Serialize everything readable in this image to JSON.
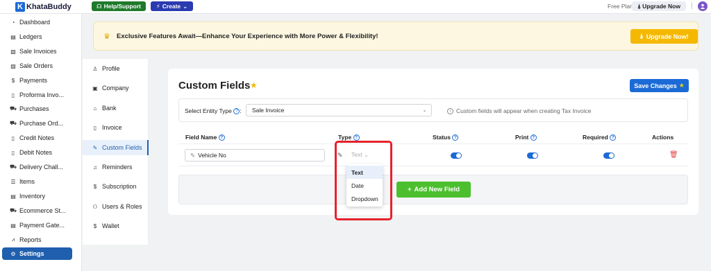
{
  "topbar": {
    "logo_letter": "K",
    "logo_text": "KhataBuddy",
    "help_label": "Help/Support",
    "create_label": "Create",
    "free_plan": "Free Plan",
    "upgrade_label": "Upgrade Now",
    "separator": "|"
  },
  "sidebar": {
    "items": [
      {
        "label": "Dashboard",
        "icon": "dashboard-icon",
        "glyph": "◔"
      },
      {
        "label": "Ledgers",
        "icon": "ledger-icon",
        "glyph": "▤"
      },
      {
        "label": "Sale Invoices",
        "icon": "invoice-icon",
        "glyph": "▧"
      },
      {
        "label": "Sale Orders",
        "icon": "order-icon",
        "glyph": "▧"
      },
      {
        "label": "Payments",
        "icon": "payments-icon",
        "glyph": "$"
      },
      {
        "label": "Proforma Invo...",
        "icon": "document-icon",
        "glyph": "▯"
      },
      {
        "label": "Purchases",
        "icon": "cart-icon",
        "glyph": "⛟"
      },
      {
        "label": "Purchase Ord...",
        "icon": "cart-icon",
        "glyph": "⛟"
      },
      {
        "label": "Credit Notes",
        "icon": "note-icon",
        "glyph": "▯"
      },
      {
        "label": "Debit Notes",
        "icon": "note-icon",
        "glyph": "▯"
      },
      {
        "label": "Delivery Chall...",
        "icon": "truck-icon",
        "glyph": "⛟"
      },
      {
        "label": "Items",
        "icon": "items-icon",
        "glyph": "☰"
      },
      {
        "label": "Inventory",
        "icon": "inventory-icon",
        "glyph": "▤"
      },
      {
        "label": "Ecommerce St...",
        "icon": "store-icon",
        "glyph": "⛟"
      },
      {
        "label": "Payment Gate...",
        "icon": "gateway-icon",
        "glyph": "▤"
      },
      {
        "label": "Reports",
        "icon": "reports-icon",
        "glyph": "⩘"
      },
      {
        "label": "Settings",
        "icon": "settings-icon",
        "glyph": "⚙"
      }
    ]
  },
  "banner": {
    "text": "Exclusive Features Await—Enhance Your Experience with More Power & Flexibility!",
    "button_label": "Upgrade Now!"
  },
  "submenu": {
    "items": [
      {
        "label": "Profile",
        "icon": "user-icon",
        "glyph": "♙"
      },
      {
        "label": "Company",
        "icon": "company-icon",
        "glyph": "▣"
      },
      {
        "label": "Bank",
        "icon": "bank-icon",
        "glyph": "⌂"
      },
      {
        "label": "Invoice",
        "icon": "invoice-icon",
        "glyph": "▯"
      },
      {
        "label": "Custom Fields",
        "icon": "custom-fields-icon",
        "glyph": "✎"
      },
      {
        "label": "Reminders",
        "icon": "bell-icon",
        "glyph": "♫"
      },
      {
        "label": "Subscription",
        "icon": "subscription-icon",
        "glyph": "$"
      },
      {
        "label": "Users & Roles",
        "icon": "users-icon",
        "glyph": "⚇"
      },
      {
        "label": "Wallet",
        "icon": "wallet-icon",
        "glyph": "$"
      }
    ]
  },
  "main": {
    "title": "Custom Fields",
    "save_label": "Save Changes",
    "entity_label": "Select Entity Type",
    "entity_value": "Sale Invoice",
    "entity_note": "Custom fields will appear when creating Tax Invoice",
    "columns": {
      "field_name": "Field Name",
      "type": "Type",
      "status": "Status",
      "print": "Print",
      "required": "Required",
      "actions": "Actions"
    },
    "row": {
      "field_name": "Vehicle No",
      "type_value": "Text",
      "status": true,
      "print": true,
      "required": true
    },
    "add_label": "Add New Field",
    "type_options": [
      "Text",
      "Date",
      "Dropdown"
    ],
    "selected_type": "Text"
  },
  "colors": {
    "accent": "#1b6ad6",
    "settings_active": "#1f5fae",
    "upgrade_yellow": "#f5b800",
    "add_green": "#4cbf2e",
    "highlight_red": "#e8202a"
  }
}
